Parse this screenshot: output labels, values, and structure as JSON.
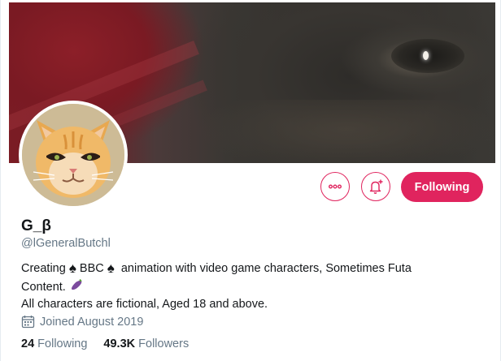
{
  "profile": {
    "display_name": "G_β",
    "handle": "@lGeneralButchl",
    "bio": {
      "line1_a": "Creating",
      "line1_spade1": "♠",
      "line1_b": "BBC",
      "line1_spade2": "♠",
      "line1_c": "animation with video game characters, Sometimes Futa",
      "line2": "Content.",
      "line2_emoji": "eggplant-emoji",
      "line3": "All characters are fictional, Aged 18 and above."
    },
    "joined": "Joined August 2019",
    "stats": {
      "following_count": "24",
      "following_label": "Following",
      "followers_count": "49.3K",
      "followers_label": "Followers"
    }
  },
  "actions": {
    "more_icon": "more-icon",
    "notify_icon": "bell-plus-icon",
    "follow_label": "Following"
  },
  "colors": {
    "accent": "#e0245e",
    "secondary_text": "#657786",
    "primary_text": "#14171a"
  }
}
